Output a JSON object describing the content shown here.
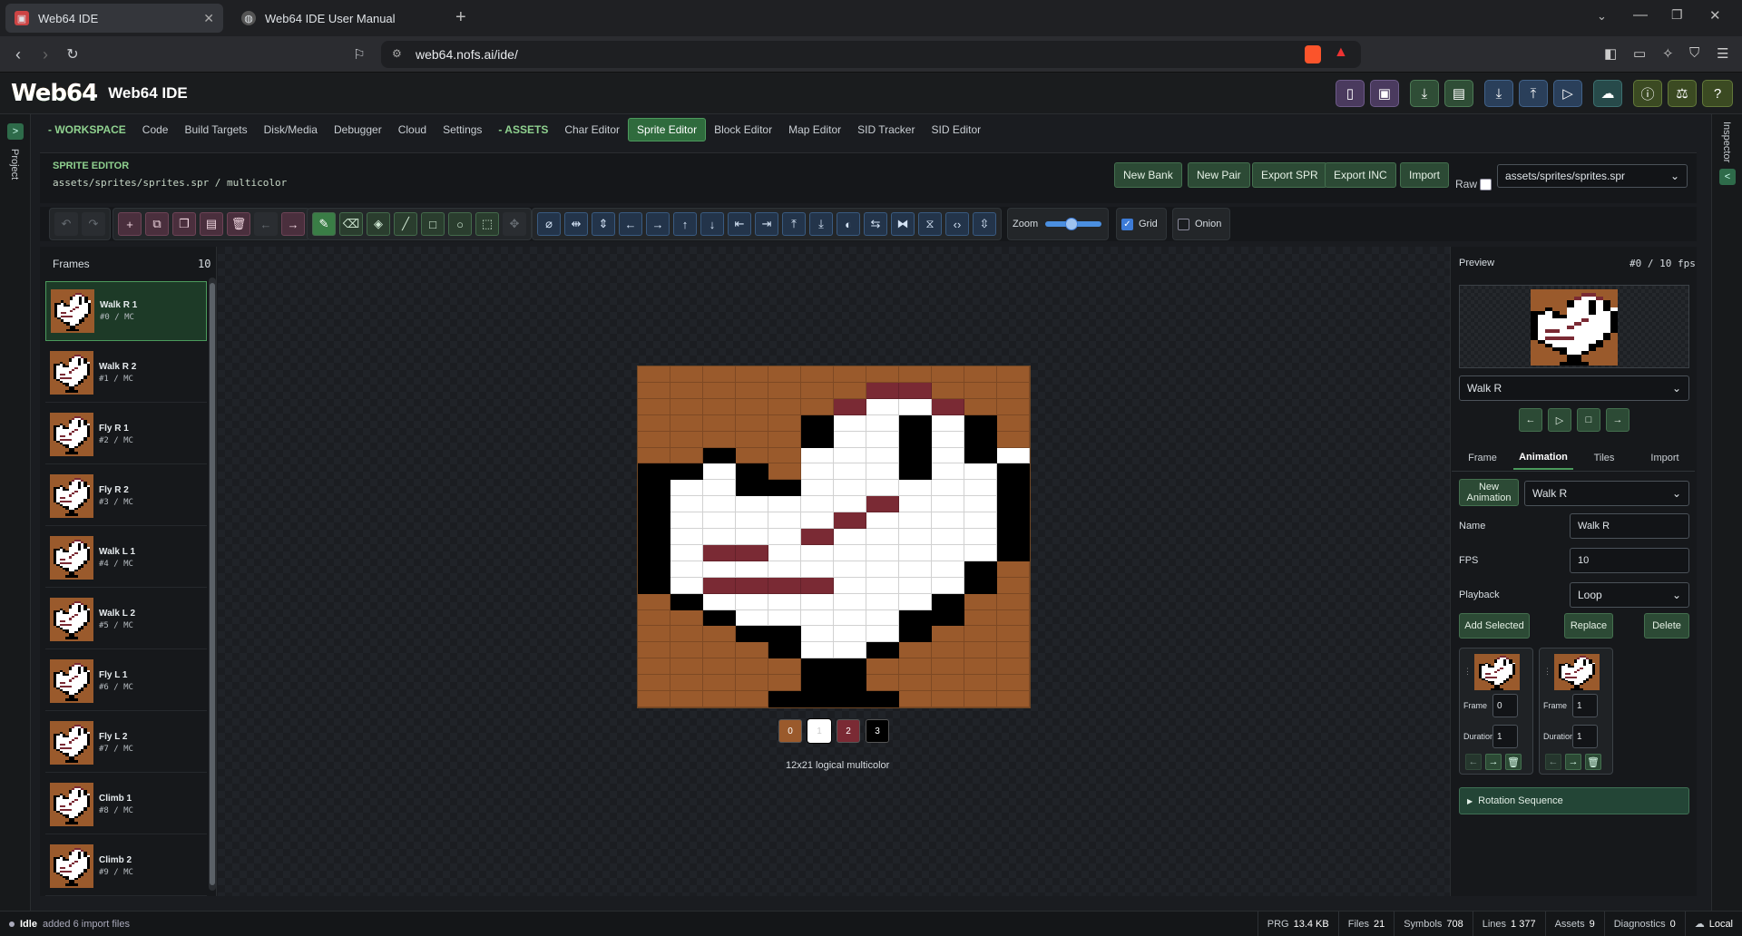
{
  "browser": {
    "tabs": [
      {
        "title": "Web64 IDE",
        "active": true
      },
      {
        "title": "Web64 IDE User Manual",
        "active": false
      }
    ],
    "url": "web64.nofs.ai/ide/"
  },
  "app": {
    "logo": "Web64",
    "title": "Web64 IDE"
  },
  "rails": {
    "left": "Project",
    "right": "Inspector"
  },
  "nav": {
    "items": [
      {
        "label": "- WORKSPACE",
        "type": "section"
      },
      {
        "label": "Code"
      },
      {
        "label": "Build Targets"
      },
      {
        "label": "Disk/Media"
      },
      {
        "label": "Debugger"
      },
      {
        "label": "Cloud"
      },
      {
        "label": "Settings"
      },
      {
        "label": "- ASSETS",
        "type": "section"
      },
      {
        "label": "Char Editor"
      },
      {
        "label": "Sprite Editor",
        "active": true
      },
      {
        "label": "Block Editor"
      },
      {
        "label": "Map Editor"
      },
      {
        "label": "SID Tracker"
      },
      {
        "label": "SID Editor"
      }
    ]
  },
  "editor": {
    "title": "SPRITE EDITOR",
    "path": "assets/sprites/sprites.spr / multicolor",
    "buttons": [
      "New Bank",
      "New Pair",
      "Export SPR",
      "Export INC",
      "Import"
    ],
    "raw_label": "Raw",
    "file_select": "assets/sprites/sprites.spr"
  },
  "toolbar": {
    "zoom_label": "Zoom",
    "zoom_value": 0.45,
    "grid_label": "Grid",
    "grid_checked": true,
    "onion_label": "Onion",
    "onion_checked": false
  },
  "frames": {
    "header": "Frames",
    "count": "10",
    "items": [
      {
        "name": "Walk R 1",
        "sub": "#0 / MC",
        "selected": true
      },
      {
        "name": "Walk R 2",
        "sub": "#1 / MC"
      },
      {
        "name": "Fly R 1",
        "sub": "#2 / MC"
      },
      {
        "name": "Fly R 2",
        "sub": "#3 / MC"
      },
      {
        "name": "Walk L 1",
        "sub": "#4 / MC"
      },
      {
        "name": "Walk L 2",
        "sub": "#5 / MC"
      },
      {
        "name": "Fly L 1",
        "sub": "#6 / MC"
      },
      {
        "name": "Fly L 2",
        "sub": "#7 / MC"
      },
      {
        "name": "Climb 1",
        "sub": "#8 / MC"
      },
      {
        "name": "Climb 2",
        "sub": "#9 / MC"
      }
    ]
  },
  "canvas": {
    "colors": {
      "0": "#9a5a2c",
      "1": "#ffffff",
      "2": "#7a2a34",
      "3": "#000000"
    },
    "palette": [
      {
        "label": "0",
        "color": "#9a5a2c",
        "text": "#ffffff"
      },
      {
        "label": "1",
        "color": "#ffffff",
        "text": "#cccccc"
      },
      {
        "label": "2",
        "color": "#7a2a34",
        "text": "#ffffff"
      },
      {
        "label": "3",
        "color": "#000000",
        "text": "#ffffff"
      }
    ],
    "pixels": [
      "000000000000",
      "000000022000",
      "000000211200",
      "000003113130",
      "000003113130",
      "003001113131",
      "331301113113",
      "311331111113",
      "311111121113",
      "311111211113",
      "311112111113",
      "312211111113",
      "311111111130",
      "312222111130",
      "031111111300",
      "003111113300",
      "000331113000",
      "000031130000",
      "000003300000",
      "000003300000",
      "000033330000"
    ],
    "dims_label": "12x21 logical multicolor"
  },
  "preview": {
    "label": "Preview",
    "info": "#0 / 10 fps",
    "anim_select": "Walk R"
  },
  "inspector": {
    "tabs": [
      "Frame",
      "Animation",
      "Tiles",
      "Import"
    ],
    "active_tab": "Animation",
    "new_animation": "New Animation",
    "anim_select": "Walk R",
    "name_label": "Name",
    "name_value": "Walk R",
    "fps_label": "FPS",
    "fps_value": "10",
    "playback_label": "Playback",
    "playback_value": "Loop",
    "add_selected": "Add Selected",
    "replace": "Replace",
    "delete": "Delete",
    "cards": [
      {
        "frame_label": "Frame",
        "frame": "0",
        "duration_label": "Duration",
        "duration": "1"
      },
      {
        "frame_label": "Frame",
        "frame": "1",
        "duration_label": "Duration",
        "duration": "1"
      }
    ],
    "rotation": "Rotation Sequence"
  },
  "status": {
    "state": "Idle",
    "message": "added 6 import files",
    "items": [
      {
        "label": "PRG",
        "value": "13.4 KB"
      },
      {
        "label": "Files",
        "value": "21"
      },
      {
        "label": "Symbols",
        "value": "708"
      },
      {
        "label": "Lines",
        "value": "1 377"
      },
      {
        "label": "Assets",
        "value": "9"
      },
      {
        "label": "Diagnostics",
        "value": "0"
      }
    ],
    "mode": "Local"
  }
}
